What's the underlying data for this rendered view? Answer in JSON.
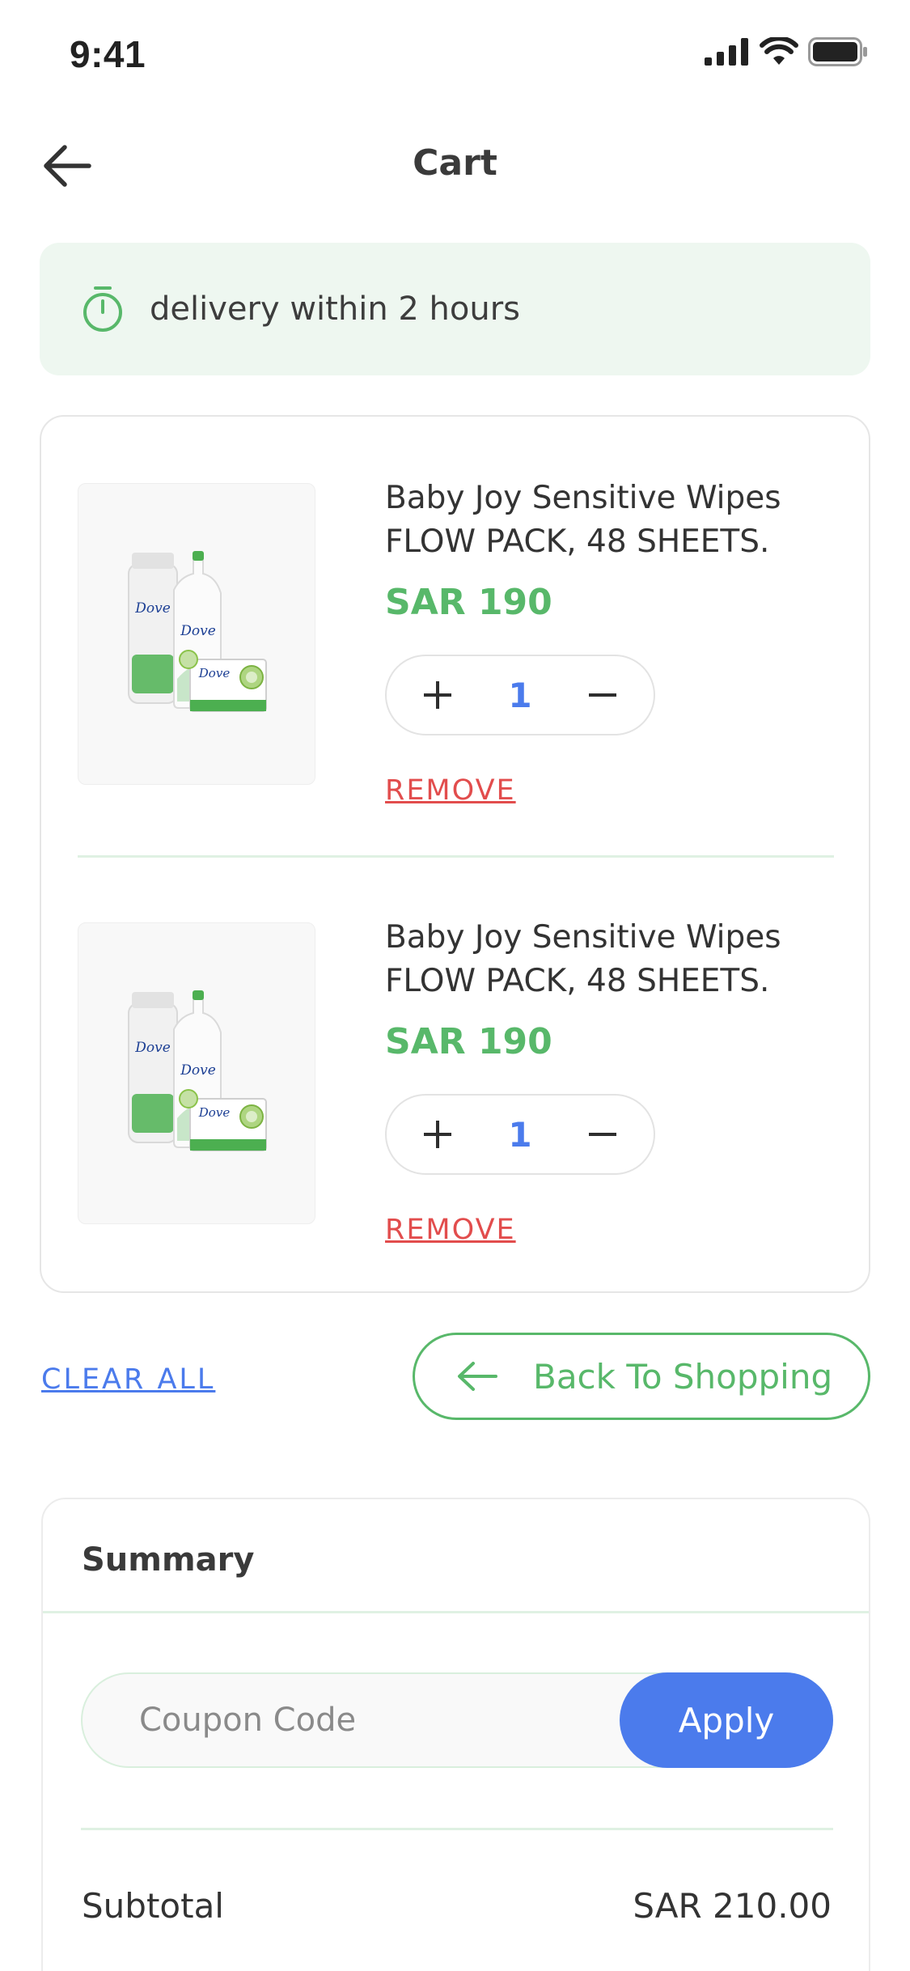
{
  "status_bar": {
    "time": "9:41"
  },
  "header": {
    "title": "Cart"
  },
  "delivery": {
    "text": "delivery within 2 hours"
  },
  "cart": {
    "items": [
      {
        "name_line1": "Baby Joy Sensitive Wipes",
        "name_line2": "FLOW PACK, 48 SHEETS.",
        "price": "SAR 190",
        "quantity": "1",
        "remove_label": "REMOVE"
      },
      {
        "name_line1": "Baby Joy Sensitive Wipes",
        "name_line2": "FLOW PACK, 48 SHEETS.",
        "price": "SAR 190",
        "quantity": "1",
        "remove_label": "REMOVE"
      }
    ]
  },
  "actions": {
    "clear_all": "CLEAR ALL",
    "back_to_shopping": "Back To Shopping"
  },
  "summary": {
    "title": "Summary",
    "coupon_placeholder": "Coupon Code",
    "apply_label": "Apply",
    "subtotal_label": "Subtotal",
    "subtotal_value": "SAR 210.00"
  },
  "colors": {
    "accent_green": "#58b86a",
    "accent_blue": "#4b7bec",
    "remove_red": "#e24d4d",
    "banner_bg": "#eef7f0"
  },
  "icons": {
    "back": "arrow-left-icon",
    "timer": "timer-icon",
    "plus": "plus-icon",
    "minus": "minus-icon"
  }
}
